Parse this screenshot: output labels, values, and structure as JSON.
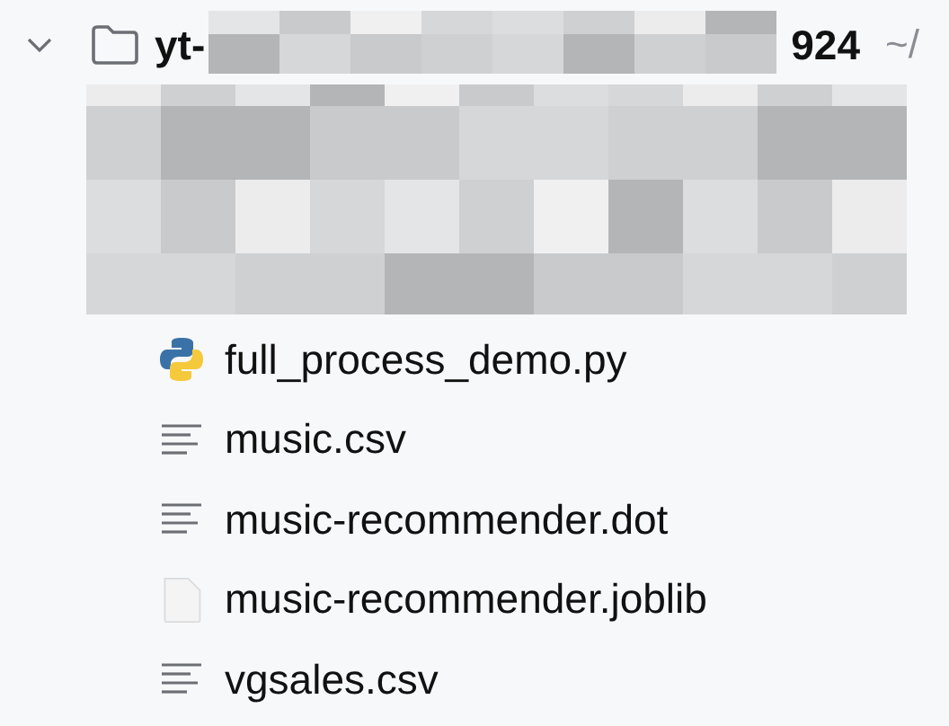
{
  "folder": {
    "name_start": "yt-",
    "name_end": "924",
    "path": "~/",
    "expanded": true
  },
  "files": [
    {
      "name": "full_process_demo.py",
      "kind": "python"
    },
    {
      "name": "music.csv",
      "kind": "text"
    },
    {
      "name": "music-recommender.dot",
      "kind": "text"
    },
    {
      "name": "music-recommender.joblib",
      "kind": "blank"
    },
    {
      "name": "vgsales.csv",
      "kind": "text"
    }
  ]
}
